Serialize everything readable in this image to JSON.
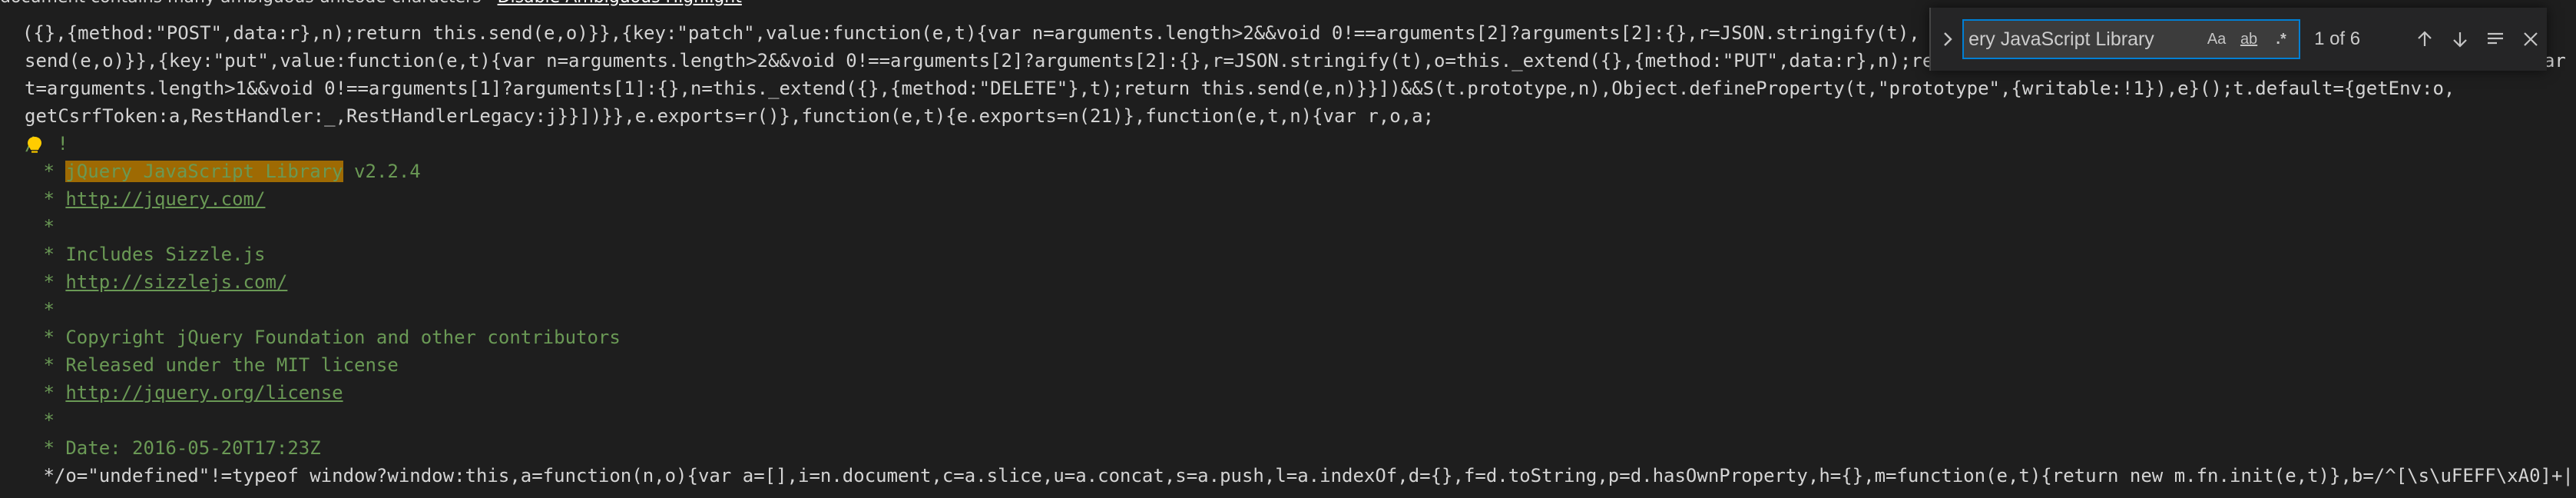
{
  "banner": {
    "text": "document contains many ambiguous unicode characters",
    "link": "Disable Ambiguous Highlight"
  },
  "code": {
    "line1": "  ({},{method:\"POST\",data:r},n);return this.send(e,o)}},{key:\"patch\",value:function(e,t){var n=arguments.length>2&&void 0!==arguments[2]?arguments[2]:{},r=JSON.stringify(t),",
    "line2": "send(e,o)}},{key:\"put\",value:function(e,t){var n=arguments.length>2&&void 0!==arguments[2]?arguments[2]:{},r=JSON.stringify(t),o=this._extend({},{method:\"PUT\",data:r},n);return this.send(e,o)}},{key:\"delete\",value:function(e){var",
    "line3": "t=arguments.length>1&&void 0!==arguments[1]?arguments[1]:{},n=this._extend({},{method:\"DELETE\"},t);return this.send(e,n)}}])&&S(t.prototype,n),Object.defineProperty(t,\"prototype\",{writable:!1}),e}();t.default={getEnv:o,",
    "line4": "getCsrfToken:a,RestHandler:_,RestHandlerLegacy:j}}])}},e.exports=r()},function(e,t){e.exports=n(21)},function(e,t,n){var r,o,a;",
    "line5_prefix": "/",
    "line5_suffix": "!",
    "line6_prefix": " * ",
    "line6_match": "jQuery JavaScript Library",
    "line6_suffix": " v2.2.4",
    "line7_prefix": " * ",
    "line7_url": "http://jquery.com/",
    "line8": " *",
    "line9": " * Includes Sizzle.js",
    "line10_prefix": " * ",
    "line10_url": "http://sizzlejs.com/",
    "line11": " *",
    "line12": " * Copyright jQuery Foundation and other contributors",
    "line13": " * Released under the MIT license",
    "line14_prefix": " * ",
    "line14_url": "http://jquery.org/license",
    "line15": " *",
    "line16": " * Date: 2016-05-20T17:23Z",
    "line17": " */o=\"undefined\"!=typeof window?window:this,a=function(n,o){var a=[],i=n.document,c=a.slice,u=a.concat,s=a.push,l=a.indexOf,d={},f=d.toString,p=d.hasOwnProperty,h={},m=function(e,t){return new m.fn.init(e,t)},b=/^[\\s\\uFEFF\\xA0]+|"
  },
  "find": {
    "query": "ery JavaScript Library",
    "match_case_label": "Aa",
    "whole_word_label": "ab",
    "regex_label": ".*",
    "count": "1 of 6",
    "icons": [
      "chevron-right-icon",
      "arrow-up-icon",
      "arrow-down-icon",
      "selection-icon",
      "close-icon"
    ]
  },
  "colors": {
    "background": "#1e1e1e",
    "comment": "#6a9955",
    "match_highlight": "#9e6a03",
    "find_border": "#007fd4"
  }
}
